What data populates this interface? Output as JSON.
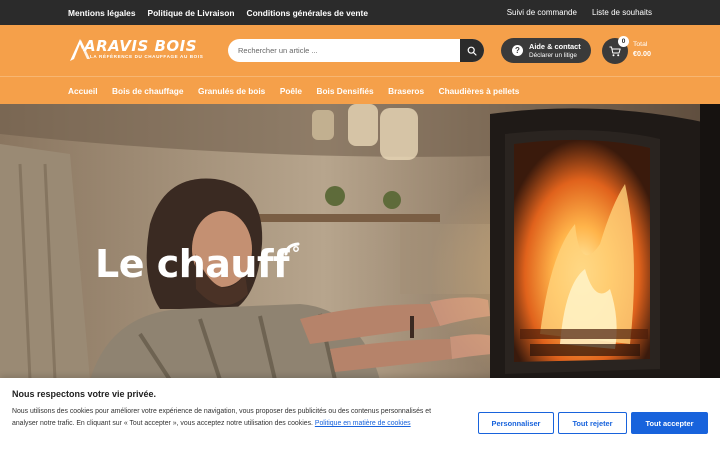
{
  "topbar": {
    "left_links": [
      "Mentions légales",
      "Politique de Livraison",
      "Conditions générales de vente"
    ],
    "right_links": [
      "Suivi de commande",
      "Liste de souhaits"
    ]
  },
  "header": {
    "logo_brand": "ARAVIS BOIS",
    "logo_tagline": "LA RÉFÉRENCE DU CHAUFFAGE AU BOIS",
    "search_placeholder": "Rechercher un article ...",
    "help_title": "Aide & contact",
    "help_subtitle": "Déclarer un litige",
    "cart_count": "0",
    "cart_total_label": "Total",
    "cart_total_value": "€0.00"
  },
  "nav": {
    "items": [
      "Accueil",
      "Bois de chauffage",
      "Granulés de bois",
      "Poêle",
      "Bois Densifiés",
      "Braseros",
      "Chaudières à pellets"
    ]
  },
  "hero": {
    "title": "Le chauff"
  },
  "cookie": {
    "title": "Nous respectons votre vie privée.",
    "text": "Nous utilisons des cookies pour améliorer votre expérience de navigation, vous proposer des publicités ou des contenus personnalisés et analyser notre trafic. En cliquant sur « Tout accepter », vous acceptez notre utilisation des cookies.",
    "policy_link": "Politique en matière de cookies",
    "btn_customize": "Personnaliser",
    "btn_reject": "Tout rejeter",
    "btn_accept": "Tout accepter"
  },
  "colors": {
    "brand_orange": "#f5a04a",
    "topbar_dark": "#2b2b2b",
    "cookie_blue": "#1863dc"
  },
  "icons": [
    "mountain-logo-icon",
    "search-icon",
    "question-icon",
    "cart-icon"
  ]
}
